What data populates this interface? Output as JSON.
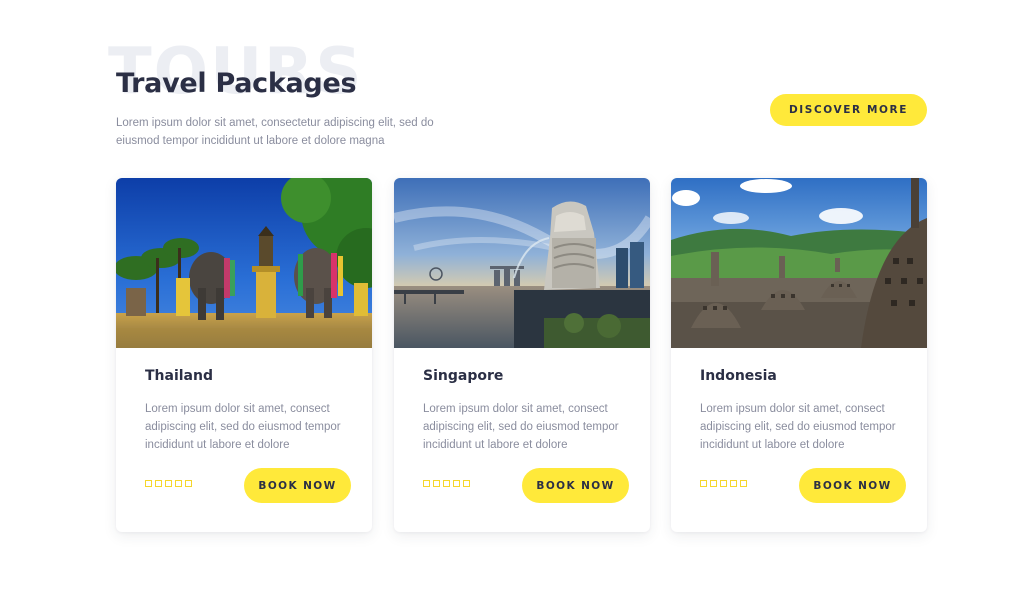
{
  "header": {
    "watermark": "TOURS",
    "title": "Travel Packages",
    "intro": "Lorem ipsum dolor sit amet, consectetur adipiscing elit, sed do eiusmod tempor incididunt ut labore et dolore magna",
    "discover_label": "DISCOVER MORE"
  },
  "cards": [
    {
      "name": "Thailand",
      "description": "Lorem ipsum dolor sit amet, consect adipiscing elit, sed do eiusmod tempor incididunt ut labore et dolore",
      "book_label": "BOOK NOW",
      "rating_max": 5,
      "image": "thailand-temple-elephants-photo"
    },
    {
      "name": "Singapore",
      "description": "Lorem ipsum dolor sit amet, consect adipiscing elit, sed do eiusmod tempor incididunt ut labore et dolore",
      "book_label": "BOOK NOW",
      "rating_max": 5,
      "image": "singapore-merlion-skyline-photo"
    },
    {
      "name": "Indonesia",
      "description": "Lorem ipsum dolor sit amet, consect adipiscing elit, sed do eiusmod tempor incididunt ut labore et dolore",
      "book_label": "BOOK NOW",
      "rating_max": 5,
      "image": "indonesia-borobudur-stupas-photo"
    }
  ],
  "colors": {
    "accent": "#ffe93a",
    "heading": "#2b2f45",
    "body_text": "#8a8d9e",
    "star_outline": "#f5d62b"
  }
}
